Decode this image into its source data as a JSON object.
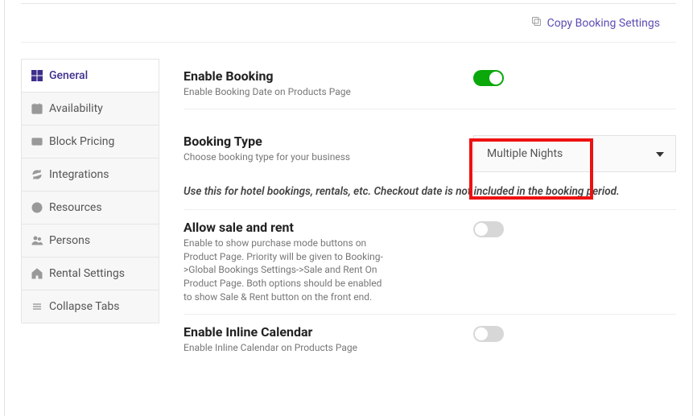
{
  "copy_link": {
    "label": "Copy Booking Settings"
  },
  "sidebar": {
    "items": [
      {
        "label": "General"
      },
      {
        "label": "Availability"
      },
      {
        "label": "Block Pricing"
      },
      {
        "label": "Integrations"
      },
      {
        "label": "Resources"
      },
      {
        "label": "Persons"
      },
      {
        "label": "Rental Settings"
      },
      {
        "label": "Collapse Tabs"
      }
    ]
  },
  "settings": {
    "enable_booking": {
      "title": "Enable Booking",
      "desc": "Enable Booking Date on Products Page",
      "value": true
    },
    "booking_type": {
      "title": "Booking Type",
      "desc": "Choose booking type for your business",
      "selected": "Multiple Nights",
      "hint": "Use this for hotel bookings, rentals, etc. Checkout date is not included in the booking period."
    },
    "allow_sale_rent": {
      "title": "Allow sale and rent",
      "desc": "Enable to show purchase mode buttons on Product Page. Priority will be given to Booking->Global Bookings Settings->Sale and Rent On Product Page. Both options should be enabled to show Sale & Rent button on the front end.",
      "value": false
    },
    "inline_calendar": {
      "title": "Enable Inline Calendar",
      "desc": "Enable Inline Calendar on Products Page",
      "value": false
    }
  }
}
